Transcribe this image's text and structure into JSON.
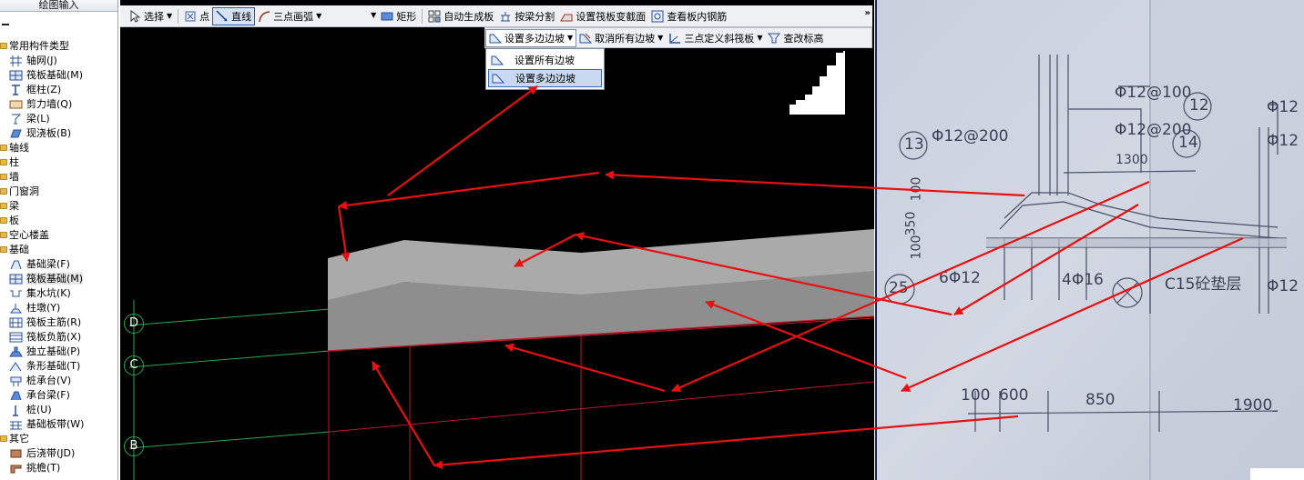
{
  "left_panel": {
    "header": "绘图输入",
    "tree": [
      {
        "type": "cat",
        "label": "常用构件类型"
      },
      {
        "type": "item",
        "label": "轴网(J)",
        "icon": "grid-icon"
      },
      {
        "type": "item",
        "label": "筏板基础(M)",
        "icon": "raft-foundation-icon"
      },
      {
        "type": "item",
        "label": "框柱(Z)",
        "icon": "column-icon"
      },
      {
        "type": "item",
        "label": "剪力墙(Q)",
        "icon": "shear-wall-icon"
      },
      {
        "type": "item",
        "label": "梁(L)",
        "icon": "beam-icon"
      },
      {
        "type": "item",
        "label": "现浇板(B)",
        "icon": "slab-icon"
      },
      {
        "type": "cat",
        "label": "轴线"
      },
      {
        "type": "cat",
        "label": "柱"
      },
      {
        "type": "cat",
        "label": "墙"
      },
      {
        "type": "cat",
        "label": "门窗洞"
      },
      {
        "type": "cat",
        "label": "梁"
      },
      {
        "type": "cat",
        "label": "板"
      },
      {
        "type": "cat",
        "label": "空心楼盖"
      },
      {
        "type": "cat",
        "label": "基础"
      },
      {
        "type": "item",
        "label": "基础梁(F)",
        "icon": "foundation-beam-icon"
      },
      {
        "type": "item",
        "label": "筏板基础(M)",
        "icon": "raft-foundation-icon",
        "selected": true
      },
      {
        "type": "item",
        "label": "集水坑(K)",
        "icon": "sump-pit-icon"
      },
      {
        "type": "item",
        "label": "柱墩(Y)",
        "icon": "column-pier-icon"
      },
      {
        "type": "item",
        "label": "筏板主筋(R)",
        "icon": "raft-main-rebar-icon"
      },
      {
        "type": "item",
        "label": "筏板负筋(X)",
        "icon": "raft-negative-rebar-icon"
      },
      {
        "type": "item",
        "label": "独立基础(P)",
        "icon": "isolated-footing-icon"
      },
      {
        "type": "item",
        "label": "条形基础(T)",
        "icon": "strip-footing-icon"
      },
      {
        "type": "item",
        "label": "桩承台(V)",
        "icon": "pile-cap-icon"
      },
      {
        "type": "item",
        "label": "承台梁(F)",
        "icon": "cap-beam-icon"
      },
      {
        "type": "item",
        "label": "桩(U)",
        "icon": "pile-icon"
      },
      {
        "type": "item",
        "label": "基础板带(W)",
        "icon": "foundation-strip-icon"
      },
      {
        "type": "cat",
        "label": "其它"
      },
      {
        "type": "item",
        "label": "后浇带(JD)",
        "icon": "post-cast-strip-icon"
      },
      {
        "type": "item",
        "label": "挑檐(T)",
        "icon": "cornice-icon"
      }
    ]
  },
  "toolbar": {
    "select": "选择",
    "point": "点",
    "line": "直线",
    "arc": "三点画弧",
    "rect": "矩形",
    "auto_slab": "自动生成板",
    "split_by_beam": "按梁分割",
    "raft_section": "设置筏板变截面",
    "view_rebar": "查看板内钢筋",
    "overflow": "»"
  },
  "toolbar2": {
    "multi_slope": "设置多边边坡",
    "cancel_edges": "取消所有边坡",
    "three_point_slope": "三点定义斜筏板",
    "check_elev": "查改标高"
  },
  "dropdown": {
    "options": [
      "设置所有边坡",
      "设置多边边坡"
    ],
    "highlighted": 1
  },
  "axes": [
    "D",
    "C",
    "B"
  ],
  "photo": {
    "labels": [
      "Φ12@100",
      "12",
      "Φ12@200",
      "14",
      "13",
      "Φ12@200",
      "1300",
      "100",
      "350",
      "100",
      "25",
      "6Φ12",
      "4Φ16",
      "C15砼垫层",
      "Φ12",
      "Φ12",
      "Φ12",
      "100",
      "600",
      "850",
      "1900"
    ]
  },
  "colors": {
    "canvas_bg": "#000000",
    "slab_top": "#aaaaaa",
    "slab_face": "#8e8e8e",
    "grid_green": "#2aa84a",
    "grid_red": "#c0182a",
    "annotation_red": "#e81010",
    "paper": "#cdd3e0",
    "highlight": "#c9d9f1"
  }
}
